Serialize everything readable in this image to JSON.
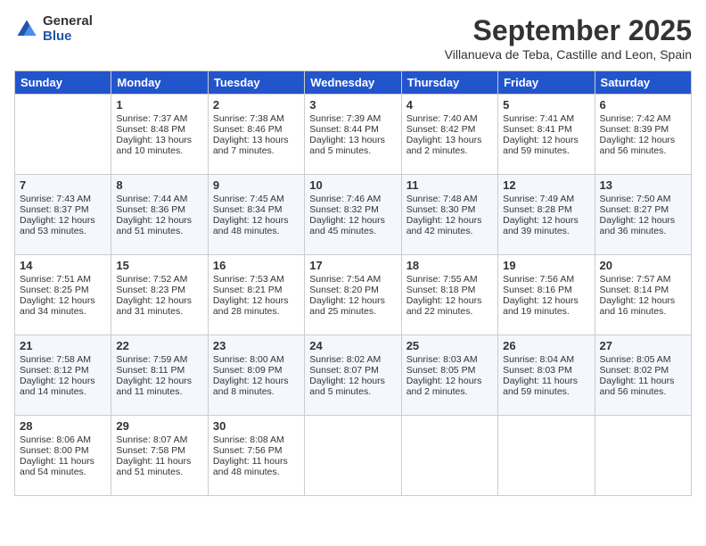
{
  "header": {
    "logo_general": "General",
    "logo_blue": "Blue",
    "month_title": "September 2025",
    "location": "Villanueva de Teba, Castille and Leon, Spain"
  },
  "columns": [
    "Sunday",
    "Monday",
    "Tuesday",
    "Wednesday",
    "Thursday",
    "Friday",
    "Saturday"
  ],
  "weeks": [
    [
      {
        "day": null
      },
      {
        "day": "1",
        "sunrise": "Sunrise: 7:37 AM",
        "sunset": "Sunset: 8:48 PM",
        "daylight": "Daylight: 13 hours and 10 minutes."
      },
      {
        "day": "2",
        "sunrise": "Sunrise: 7:38 AM",
        "sunset": "Sunset: 8:46 PM",
        "daylight": "Daylight: 13 hours and 7 minutes."
      },
      {
        "day": "3",
        "sunrise": "Sunrise: 7:39 AM",
        "sunset": "Sunset: 8:44 PM",
        "daylight": "Daylight: 13 hours and 5 minutes."
      },
      {
        "day": "4",
        "sunrise": "Sunrise: 7:40 AM",
        "sunset": "Sunset: 8:42 PM",
        "daylight": "Daylight: 13 hours and 2 minutes."
      },
      {
        "day": "5",
        "sunrise": "Sunrise: 7:41 AM",
        "sunset": "Sunset: 8:41 PM",
        "daylight": "Daylight: 12 hours and 59 minutes."
      },
      {
        "day": "6",
        "sunrise": "Sunrise: 7:42 AM",
        "sunset": "Sunset: 8:39 PM",
        "daylight": "Daylight: 12 hours and 56 minutes."
      }
    ],
    [
      {
        "day": "7",
        "sunrise": "Sunrise: 7:43 AM",
        "sunset": "Sunset: 8:37 PM",
        "daylight": "Daylight: 12 hours and 53 minutes."
      },
      {
        "day": "8",
        "sunrise": "Sunrise: 7:44 AM",
        "sunset": "Sunset: 8:36 PM",
        "daylight": "Daylight: 12 hours and 51 minutes."
      },
      {
        "day": "9",
        "sunrise": "Sunrise: 7:45 AM",
        "sunset": "Sunset: 8:34 PM",
        "daylight": "Daylight: 12 hours and 48 minutes."
      },
      {
        "day": "10",
        "sunrise": "Sunrise: 7:46 AM",
        "sunset": "Sunset: 8:32 PM",
        "daylight": "Daylight: 12 hours and 45 minutes."
      },
      {
        "day": "11",
        "sunrise": "Sunrise: 7:48 AM",
        "sunset": "Sunset: 8:30 PM",
        "daylight": "Daylight: 12 hours and 42 minutes."
      },
      {
        "day": "12",
        "sunrise": "Sunrise: 7:49 AM",
        "sunset": "Sunset: 8:28 PM",
        "daylight": "Daylight: 12 hours and 39 minutes."
      },
      {
        "day": "13",
        "sunrise": "Sunrise: 7:50 AM",
        "sunset": "Sunset: 8:27 PM",
        "daylight": "Daylight: 12 hours and 36 minutes."
      }
    ],
    [
      {
        "day": "14",
        "sunrise": "Sunrise: 7:51 AM",
        "sunset": "Sunset: 8:25 PM",
        "daylight": "Daylight: 12 hours and 34 minutes."
      },
      {
        "day": "15",
        "sunrise": "Sunrise: 7:52 AM",
        "sunset": "Sunset: 8:23 PM",
        "daylight": "Daylight: 12 hours and 31 minutes."
      },
      {
        "day": "16",
        "sunrise": "Sunrise: 7:53 AM",
        "sunset": "Sunset: 8:21 PM",
        "daylight": "Daylight: 12 hours and 28 minutes."
      },
      {
        "day": "17",
        "sunrise": "Sunrise: 7:54 AM",
        "sunset": "Sunset: 8:20 PM",
        "daylight": "Daylight: 12 hours and 25 minutes."
      },
      {
        "day": "18",
        "sunrise": "Sunrise: 7:55 AM",
        "sunset": "Sunset: 8:18 PM",
        "daylight": "Daylight: 12 hours and 22 minutes."
      },
      {
        "day": "19",
        "sunrise": "Sunrise: 7:56 AM",
        "sunset": "Sunset: 8:16 PM",
        "daylight": "Daylight: 12 hours and 19 minutes."
      },
      {
        "day": "20",
        "sunrise": "Sunrise: 7:57 AM",
        "sunset": "Sunset: 8:14 PM",
        "daylight": "Daylight: 12 hours and 16 minutes."
      }
    ],
    [
      {
        "day": "21",
        "sunrise": "Sunrise: 7:58 AM",
        "sunset": "Sunset: 8:12 PM",
        "daylight": "Daylight: 12 hours and 14 minutes."
      },
      {
        "day": "22",
        "sunrise": "Sunrise: 7:59 AM",
        "sunset": "Sunset: 8:11 PM",
        "daylight": "Daylight: 12 hours and 11 minutes."
      },
      {
        "day": "23",
        "sunrise": "Sunrise: 8:00 AM",
        "sunset": "Sunset: 8:09 PM",
        "daylight": "Daylight: 12 hours and 8 minutes."
      },
      {
        "day": "24",
        "sunrise": "Sunrise: 8:02 AM",
        "sunset": "Sunset: 8:07 PM",
        "daylight": "Daylight: 12 hours and 5 minutes."
      },
      {
        "day": "25",
        "sunrise": "Sunrise: 8:03 AM",
        "sunset": "Sunset: 8:05 PM",
        "daylight": "Daylight: 12 hours and 2 minutes."
      },
      {
        "day": "26",
        "sunrise": "Sunrise: 8:04 AM",
        "sunset": "Sunset: 8:03 PM",
        "daylight": "Daylight: 11 hours and 59 minutes."
      },
      {
        "day": "27",
        "sunrise": "Sunrise: 8:05 AM",
        "sunset": "Sunset: 8:02 PM",
        "daylight": "Daylight: 11 hours and 56 minutes."
      }
    ],
    [
      {
        "day": "28",
        "sunrise": "Sunrise: 8:06 AM",
        "sunset": "Sunset: 8:00 PM",
        "daylight": "Daylight: 11 hours and 54 minutes."
      },
      {
        "day": "29",
        "sunrise": "Sunrise: 8:07 AM",
        "sunset": "Sunset: 7:58 PM",
        "daylight": "Daylight: 11 hours and 51 minutes."
      },
      {
        "day": "30",
        "sunrise": "Sunrise: 8:08 AM",
        "sunset": "Sunset: 7:56 PM",
        "daylight": "Daylight: 11 hours and 48 minutes."
      },
      {
        "day": null
      },
      {
        "day": null
      },
      {
        "day": null
      },
      {
        "day": null
      }
    ]
  ]
}
